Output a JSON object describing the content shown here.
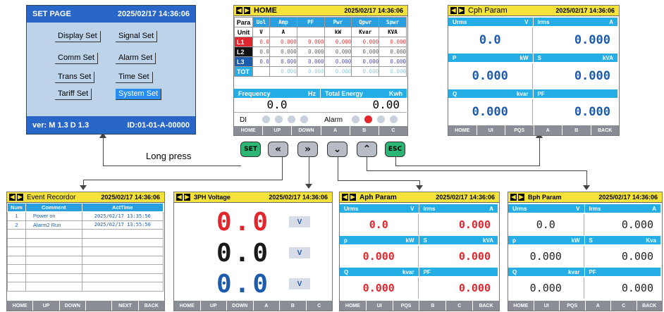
{
  "set_page": {
    "title": "SET PAGE",
    "datetime": "2025/02/17 14:36:06",
    "buttons": [
      "Display Set",
      "Signal Set",
      "Comm Set",
      "Alarm Set",
      "Trans Set",
      "Time Set",
      "Tariff Set",
      "System Set"
    ],
    "version": "ver: M 1.3   D 1.3",
    "id": "ID:01-01-A-00000"
  },
  "home": {
    "title": "HOME",
    "datetime": "2025/02/17 14:36:06",
    "headers": [
      "Para",
      "Uol",
      "Amp",
      "PF",
      "Pwr",
      "Qpwr",
      "Spwr"
    ],
    "units": [
      "Unit",
      "V",
      "A",
      "",
      "kW",
      "Kvar",
      "KVA"
    ],
    "rows": [
      {
        "label": "L1",
        "vals": [
          "0.0",
          "0.000",
          "0.000",
          "0.000",
          "0.000",
          "0.000"
        ]
      },
      {
        "label": "L2",
        "vals": [
          "0.0",
          "0.000",
          "0.000",
          "0.000",
          "0.000",
          "0.000"
        ]
      },
      {
        "label": "L3",
        "vals": [
          "0.0",
          "0.000",
          "0.000",
          "0.000",
          "0.000",
          "0.000"
        ]
      },
      {
        "label": "TOT",
        "vals": [
          "",
          "0.000",
          "0.000",
          "0.000",
          "0.000",
          "0.000"
        ]
      }
    ],
    "freq_label": "Frequency",
    "freq_unit": "Hz",
    "freq_val": "0.0",
    "energy_label": "Total Energy",
    "energy_unit": "Kwh",
    "energy_val": "0.00",
    "di": "DI",
    "alarm": "Alarm",
    "footer": [
      "HOME",
      "UP",
      "DOWN",
      "A",
      "B",
      "C"
    ]
  },
  "cph": {
    "title": "Cph Param",
    "datetime": "2025/02/17 14:36:06",
    "cells": [
      {
        "k": "Urms",
        "u": "V",
        "v": "0.0"
      },
      {
        "k": "Irms",
        "u": "A",
        "v": "0.000"
      },
      {
        "k": "P",
        "u": "kW",
        "v": "0.000"
      },
      {
        "k": "S",
        "u": "kVA",
        "v": "0.000"
      },
      {
        "k": "Q",
        "u": "kvar",
        "v": "0.000"
      },
      {
        "k": "PF",
        "u": "",
        "v": "0.000"
      }
    ],
    "footer": [
      "HOME",
      "UI",
      "PQS",
      "A",
      "B",
      "BACK"
    ]
  },
  "keys": [
    "SET",
    "«",
    "»",
    "⌄",
    "⌃",
    "ESC"
  ],
  "long_press": "Long press",
  "event": {
    "title": "Event Recordor",
    "datetime": "2025/02/17 14:36:06",
    "headers": [
      "Num",
      "Comment",
      "ActTime"
    ],
    "rows": [
      [
        "1",
        "Power on",
        "2025/02/17 13:35:56"
      ],
      [
        "2",
        "Alarm2 Run",
        "2025/02/17 13:55:50"
      ]
    ],
    "footer": [
      "HOME",
      "UP",
      "DOWN",
      "",
      "NEXT",
      "BACK"
    ]
  },
  "volt": {
    "title": "3PH Voltage",
    "datetime": "2025/02/17 14:36:06",
    "values": [
      "0.0",
      "0.0",
      "0.0"
    ],
    "unit": "V",
    "colors": [
      "#e3262d",
      "#1a1a1a",
      "#1d5bad"
    ],
    "footer": [
      "HOME",
      "UP",
      "DOWN",
      "A",
      "B",
      "C"
    ]
  },
  "aph": {
    "title": "Aph Param",
    "datetime": "2025/02/17 14:36:06",
    "cells": [
      {
        "k": "Urms",
        "u": "V",
        "v": "0.0"
      },
      {
        "k": "Irms",
        "u": "A",
        "v": "0.000"
      },
      {
        "k": "p",
        "u": "kW",
        "v": "0.000"
      },
      {
        "k": "S",
        "u": "kVA",
        "v": "0.000"
      },
      {
        "k": "Q",
        "u": "kvar",
        "v": "0.000"
      },
      {
        "k": "PF",
        "u": "",
        "v": "0.000"
      }
    ],
    "footer": [
      "HOME",
      "UI",
      "PQS",
      "B",
      "C",
      "BACK"
    ]
  },
  "bph": {
    "title": "Bph Param",
    "datetime": "2025/02/17 14:36:06",
    "cells": [
      {
        "k": "Urms",
        "u": "V",
        "v": "0.0"
      },
      {
        "k": "Irms",
        "u": "A",
        "v": "0.000"
      },
      {
        "k": "p",
        "u": "kW",
        "v": "0.000"
      },
      {
        "k": "S",
        "u": "Kva",
        "v": "0.000"
      },
      {
        "k": "Q",
        "u": "kvar",
        "v": "0.000"
      },
      {
        "k": "PF",
        "u": "",
        "v": "0.000"
      }
    ],
    "footer": [
      "HOME",
      "UI",
      "PQS",
      "A",
      "C",
      "BACK"
    ]
  }
}
